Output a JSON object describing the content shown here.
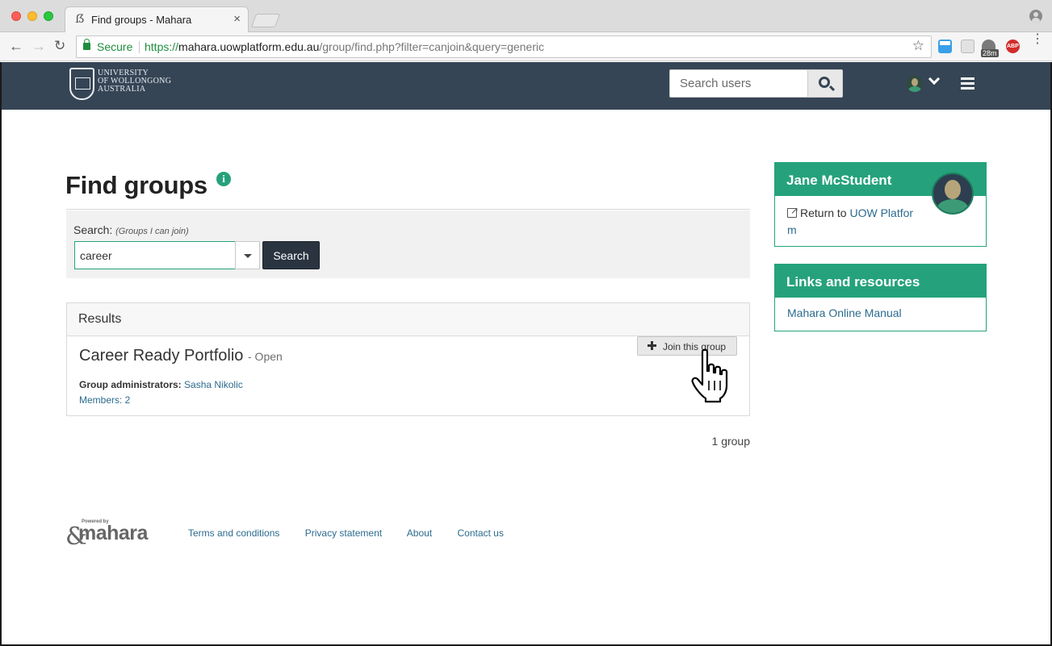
{
  "browser": {
    "tab_title": "Find groups - Mahara",
    "tab_close": "×",
    "favicon_glyph": "ẞ",
    "secure_label": "Secure",
    "url_scheme": "https://",
    "url_host": "mahara.uowplatform.edu.au",
    "url_path": "/group/find.php?filter=canjoin&query=generic",
    "back_glyph": "←",
    "forward_glyph": "→",
    "reload_glyph": "↻",
    "star_glyph": "☆",
    "ext_timer_badge": "28m",
    "ext_adblock_label": "ABP",
    "menu_glyph": "⋮"
  },
  "header": {
    "logo_lines": [
      "UNIVERSITY",
      "OF WOLLONGONG",
      "AUSTRALIA"
    ],
    "search_placeholder": "Search users"
  },
  "page": {
    "title": "Find groups",
    "info_glyph": "i"
  },
  "search": {
    "label": "Search:",
    "label_note": "(Groups I can join)",
    "query_value": "career",
    "button_label": "Search"
  },
  "results": {
    "heading": "Results",
    "groups": [
      {
        "name": "Career Ready Portfolio",
        "type_suffix": "- Open",
        "admins_label": "Group administrators:",
        "admin_name": "Sasha Nikolic",
        "members_text": "Members: 2",
        "join_label": "Join this group"
      }
    ],
    "count_text": "1 group"
  },
  "sidebar": {
    "user_card": {
      "name": "Jane McStudent",
      "return_prefix": "Return to ",
      "return_link_line1": "UOW Platfor",
      "return_link_line2": "m"
    },
    "links_card": {
      "heading": "Links and resources",
      "manual_link": "Mahara Online Manual"
    }
  },
  "footer": {
    "powered_by": "Powered by",
    "logo_word": "mahara",
    "links": [
      "Terms and conditions",
      "Privacy statement",
      "About",
      "Contact us"
    ]
  },
  "colors": {
    "accent_green": "#25a27b",
    "header_bg": "#364555",
    "link_blue": "#2c6b8e",
    "button_dark": "#2a3440"
  }
}
